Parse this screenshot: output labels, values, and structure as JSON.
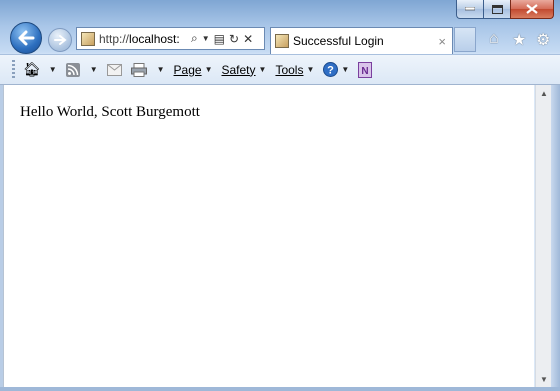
{
  "window": {
    "caption_buttons": [
      "minimize",
      "maximize",
      "close"
    ]
  },
  "address_bar": {
    "url_prefix": "http://",
    "url_host": "localhost:",
    "icons": [
      "search-icon",
      "dropdown-icon",
      "compatibility-icon",
      "refresh-icon",
      "stop-icon"
    ]
  },
  "tab": {
    "title": "Successful Login",
    "close": "×"
  },
  "command_bar": {
    "page": "Page",
    "safety": "Safety",
    "tools": "Tools"
  },
  "content": {
    "text": "Hello World, Scott Burgemott"
  }
}
